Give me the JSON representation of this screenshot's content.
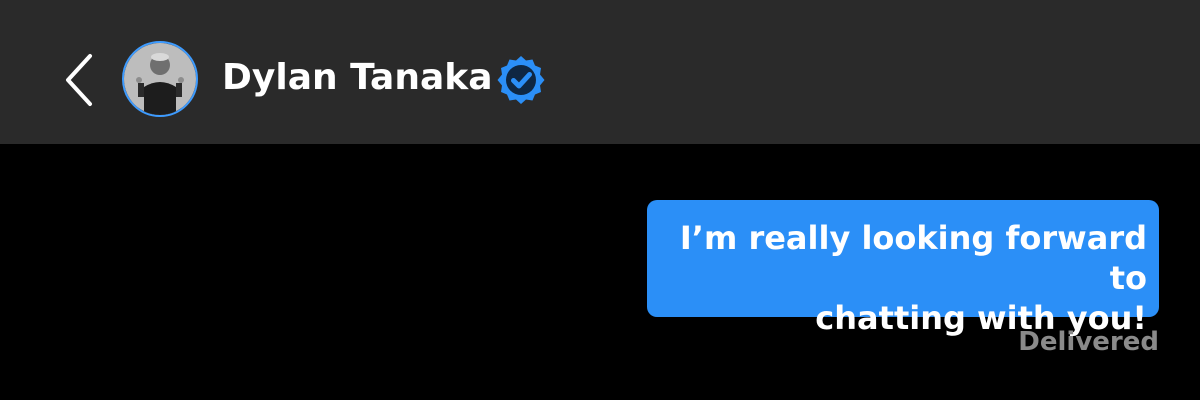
{
  "colors": {
    "header_background": "#2a2a2a",
    "screen_background": "#000000",
    "bubble_background": "#2b8ff7",
    "verified_badge": "#2b8ff7",
    "avatar_ring": "#3d9bff",
    "status_text": "#8a8a8a",
    "primary_text": "#ffffff"
  },
  "header": {
    "back_icon": "chevron-left-icon",
    "avatar_icon": "profile-photo",
    "contact_name": "Dylan Tanaka",
    "verified_icon": "verified-badge-icon"
  },
  "conversation": {
    "messages": [
      {
        "direction": "outgoing",
        "text": "I’m really looking forward to\nchatting with you!"
      }
    ],
    "status": "Delivered"
  }
}
